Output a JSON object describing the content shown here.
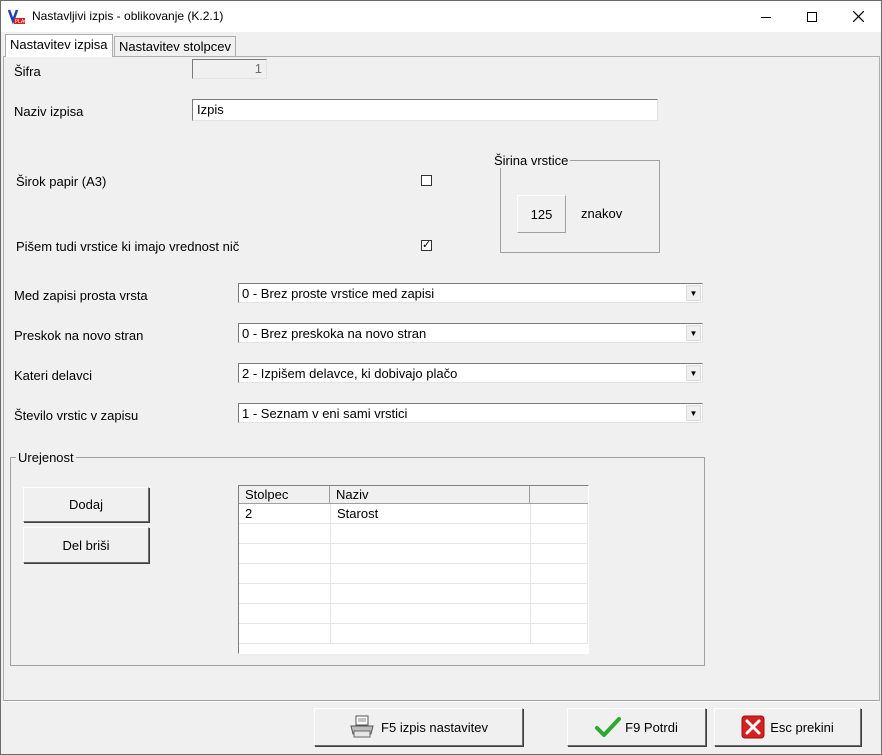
{
  "window": {
    "title": "Nastavljivi izpis - oblikovanje  (K.2.1)",
    "minimize": "—",
    "maximize": "☐",
    "close": "✕"
  },
  "tabs": [
    {
      "label": "Nastavitev izpisa",
      "active": true
    },
    {
      "label": "Nastavitev stolpcev",
      "active": false
    }
  ],
  "form": {
    "sifra_label": "Šifra",
    "sifra_value": "1",
    "naziv_label": "Naziv izpisa",
    "naziv_value": "Izpis",
    "sirok_papir_label": "Širok papir (A3)",
    "sirok_papir_checked": false,
    "pisem_label": "Pišem tudi vrstice ki imajo vrednost nič",
    "pisem_checked": true,
    "pisem_check_glyph": "✓",
    "sirina": {
      "title": "Širina vrstice",
      "value": "125",
      "unit": "znakov"
    },
    "med_zapisi_label": "Med zapisi prosta vrsta",
    "med_zapisi_value": "0 - Brez proste vrstice med zapisi",
    "preskok_label": "Preskok na novo stran",
    "preskok_value": "0 - Brez preskoka na novo stran",
    "kateri_label": "Kateri delavci",
    "kateri_value": "2 - Izpišem delavce, ki dobivajo plačo",
    "stevilo_label": "Število vrstic v zapisu",
    "stevilo_value": "1 - Seznam v eni sami vrstici",
    "dropdown_arrow": "▼"
  },
  "urejenost": {
    "title": "Urejenost",
    "add_button": "Dodaj",
    "delete_button": "Del briši",
    "columns": [
      "Stolpec",
      "Naziv"
    ],
    "rows": [
      {
        "stolpec": "2",
        "naziv": "Starost"
      }
    ]
  },
  "footer": {
    "print_button": "F5 izpis nastavitev",
    "confirm_button": "F9 Potrdi",
    "cancel_button": "Esc  prekini"
  },
  "colors": {
    "confirm_check": "#2ea82e",
    "cancel_red": "#d42020"
  }
}
